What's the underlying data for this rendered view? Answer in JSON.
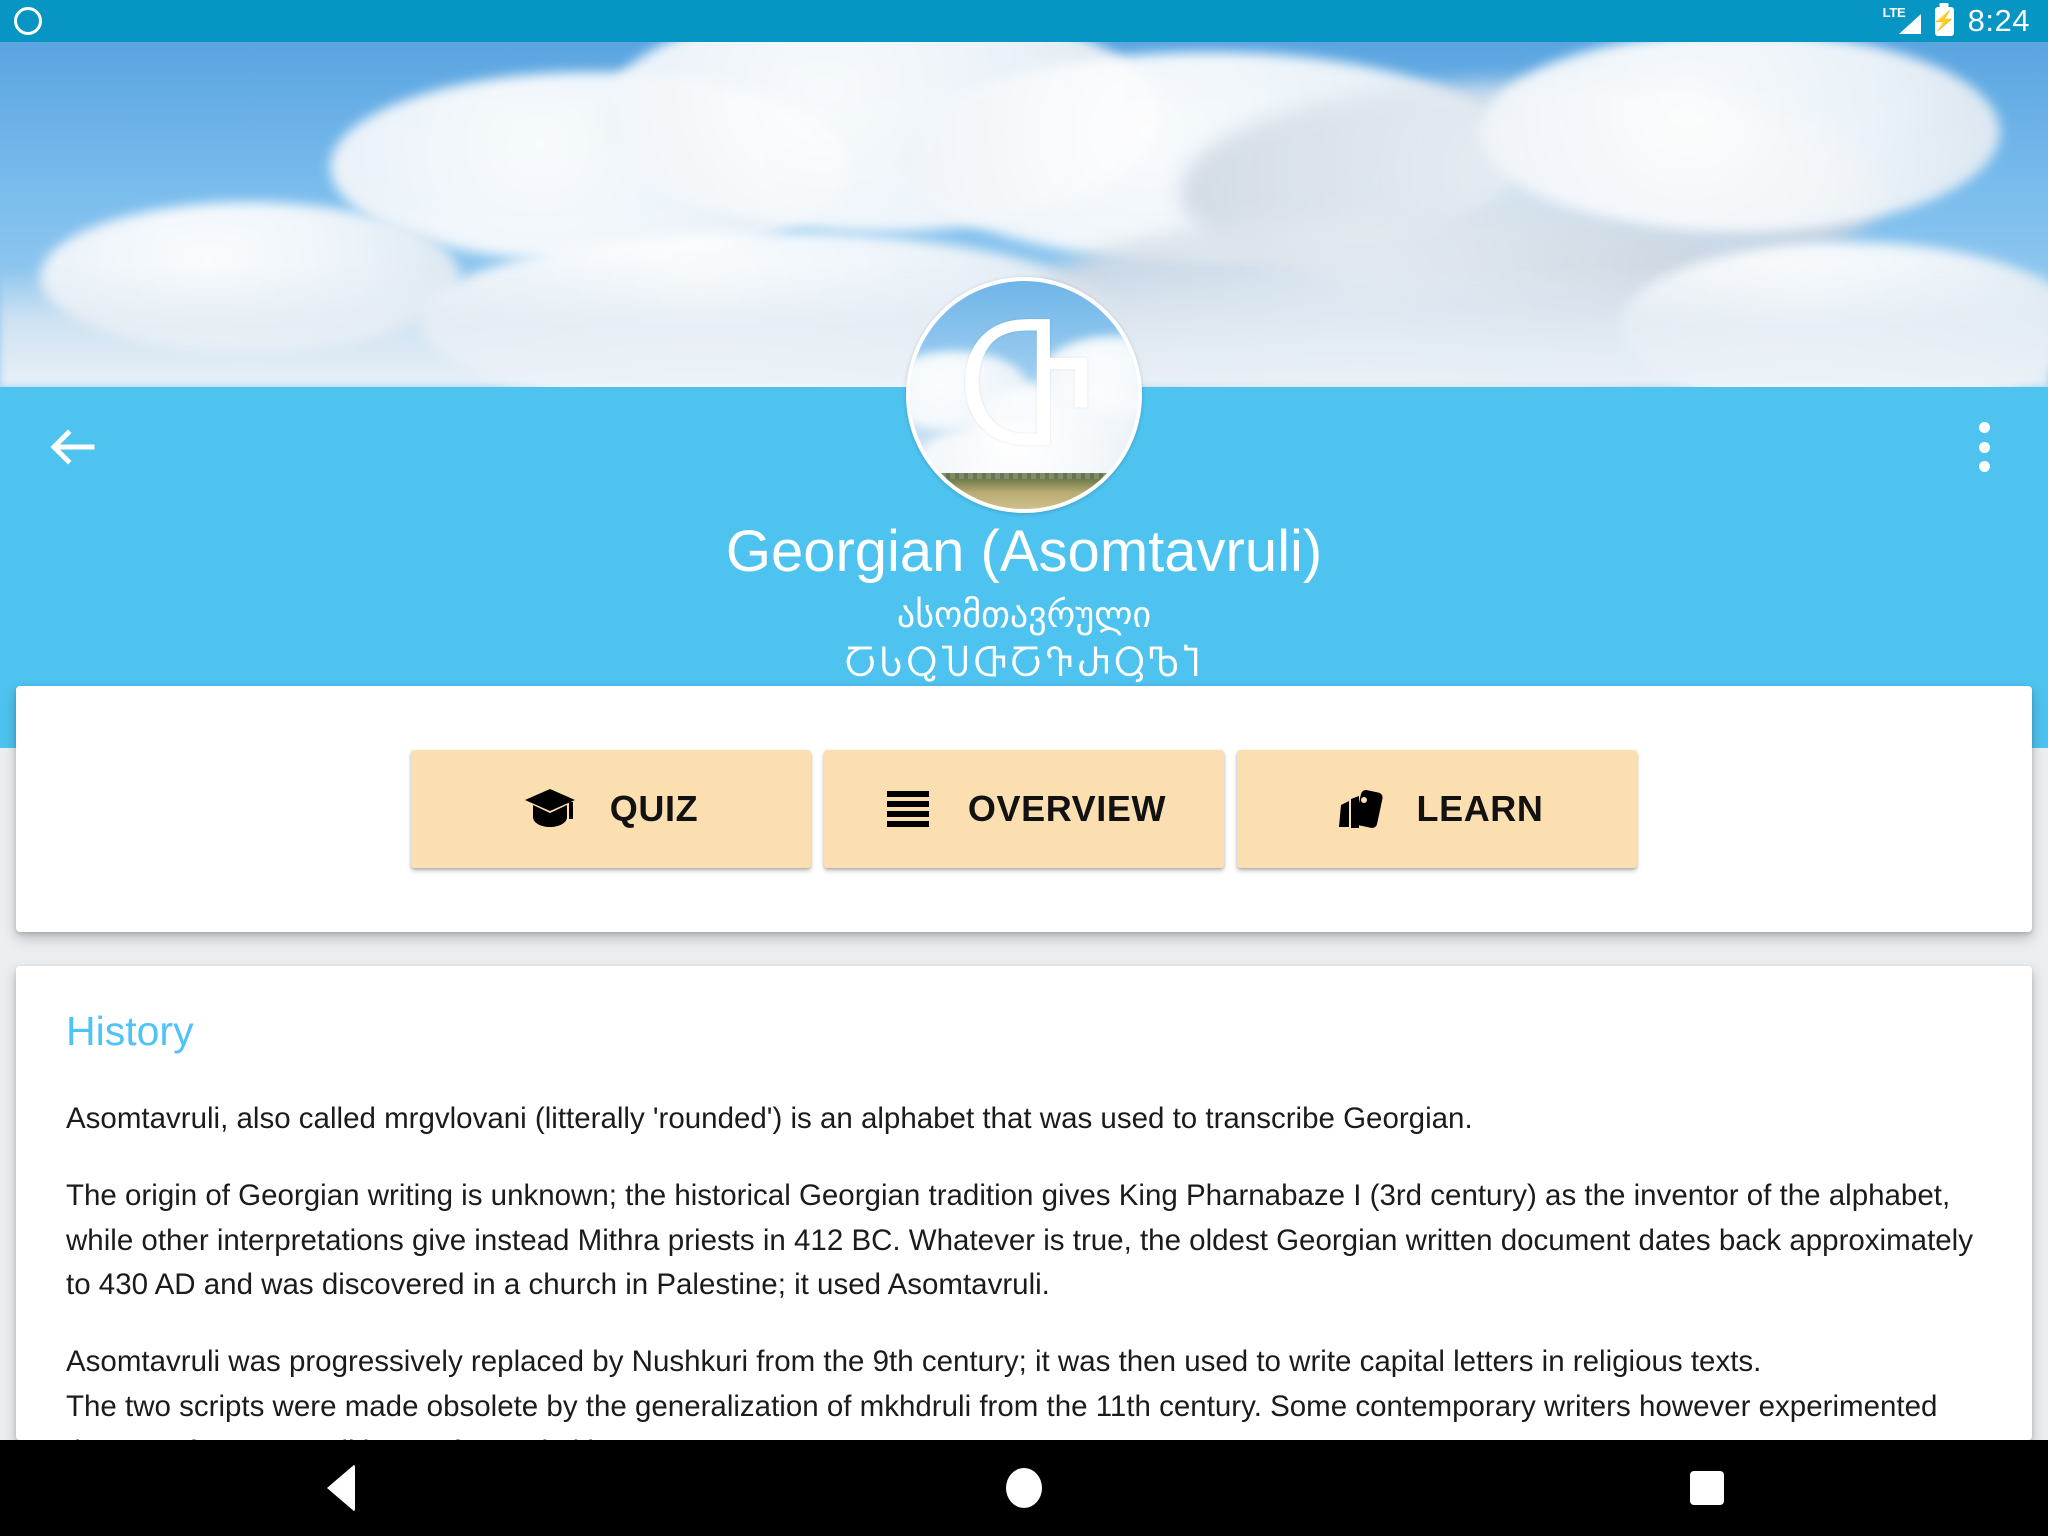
{
  "statusbar": {
    "notification_icon": "app-notification-icon",
    "network_label": "LTE",
    "battery_icon": "battery-charging-icon",
    "bolt_glyph": "⚡",
    "time": "8:24"
  },
  "appbar": {
    "back_icon": "back-arrow-icon",
    "overflow_icon": "overflow-menu-icon"
  },
  "hero": {
    "avatar_letter": "Ⴇ",
    "avatar_name": "alphabet-avatar",
    "title": "Georgian (Asomtavruli)",
    "native_name": "ასომთავრული",
    "script_name": "ႠႱႭႮႧႠႥႰႳႪႨ"
  },
  "actions": [
    {
      "id": "quiz",
      "label": "QUIZ",
      "icon": "graduation-cap-icon"
    },
    {
      "id": "overview",
      "label": "OVERVIEW",
      "icon": "list-icon"
    },
    {
      "id": "learn",
      "label": "LEARN",
      "icon": "flashcards-icon"
    }
  ],
  "history": {
    "heading": "History",
    "paragraphs": [
      "Asomtavruli, also called mrgvlovani (litterally 'rounded') is an alphabet that was used to transcribe Georgian.",
      "The origin of Georgian writing is unknown; the historical Georgian tradition gives King Pharnabaze I (3rd century) as the inventor of the alphabet, while other interpretations give instead Mithra priests  in 412 BC. Whatever is true, the oldest Georgian written document dates back approximately to 430 AD and was discovered in a church in Palestine; it used Asomtavruli.",
      "Asomtavruli was progressively replaced by Nushkuri from the 9th century; it was then used to write capital letters in religious texts.\nThe two scripts were made obsolete by the generalization of mkhdruli from the 11th century. Some contemporary writers however experimented the use of asomtavruli letters for capital letters."
    ]
  },
  "navbar": {
    "back": "android-back-button",
    "home": "android-home-button",
    "recents": "android-recents-button"
  },
  "colors": {
    "statusbar": "#0795c4",
    "accent_band": "#4ec3f0",
    "section_heading": "#4fc3f7",
    "button_fill": "#fbdfb1"
  }
}
